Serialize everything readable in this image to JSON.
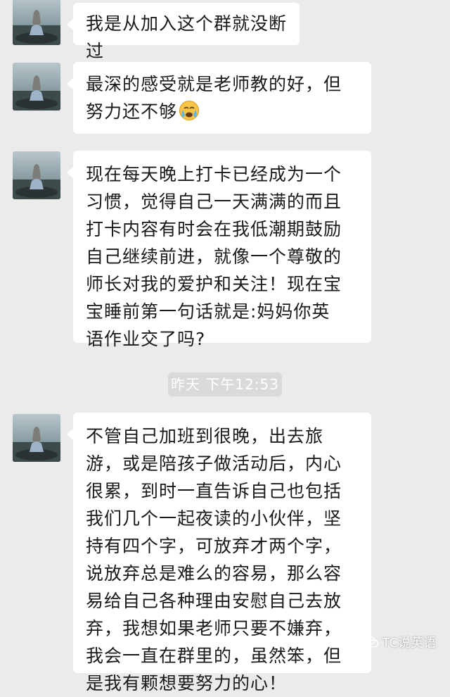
{
  "conversation": {
    "messages": [
      {
        "sender_avatar": "avatar-girl-by-sea",
        "lines": [
          "我是从加入这个群就没断过"
        ]
      },
      {
        "sender_avatar": "avatar-girl-by-sea",
        "lines": [
          "最深的感受就是老师教的好，但",
          "努力还不够"
        ],
        "emoji": "crying-face-icon"
      },
      {
        "sender_avatar": "avatar-girl-by-sea",
        "lines": [
          "现在每天晚上打卡已经成为一个",
          "习惯，觉得自己一天满满的而且",
          "打卡内容有时会在我低潮期鼓励",
          "自己继续前进，就像一个尊敬的",
          "师长对我的爱护和关注！现在宝",
          "宝睡前第一句话就是:妈妈你英",
          "语作业交了吗?"
        ]
      },
      {
        "sender_avatar": "avatar-girl-by-sea",
        "lines": [
          "不管自己加班到很晚，出去旅",
          "游，或是陪孩子做活动后，内心",
          "很累，到时一直告诉自己也包括",
          "我们几个一起夜读的小伙伴，坚",
          "持有四个字，可放弃才两个字，",
          "说放弃总是难么的容易，那么容",
          "易给自己各种理由安慰自己去放",
          "弃，我想如果老师只要不嫌弃，",
          "我会一直在群里的，虽然笨，但",
          "是我有颗想要努力的心！"
        ]
      }
    ],
    "timestamp": "昨天 下午12:53"
  },
  "watermark": {
    "icon": "wechat-icon",
    "text": "TC说英语"
  },
  "colors": {
    "background": "#ebebeb",
    "bubble": "#ffffff",
    "timestamp_pill": "#dadada"
  }
}
